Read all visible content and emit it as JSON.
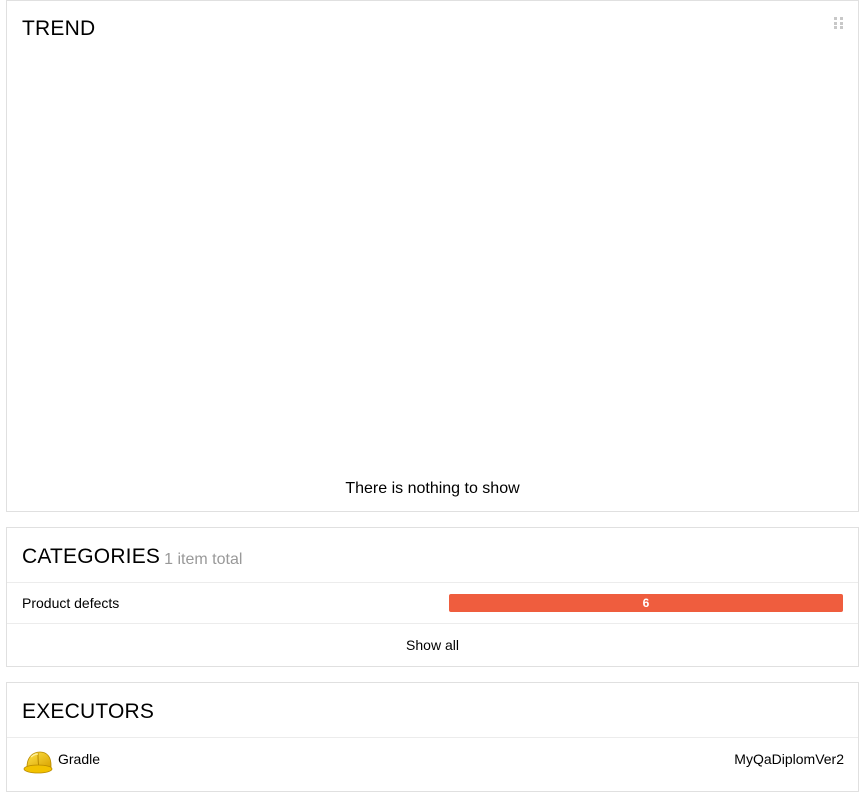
{
  "trend": {
    "title": "TREND",
    "empty_message": "There is nothing to show"
  },
  "categories": {
    "title": "CATEGORIES",
    "subtitle": "1 item total",
    "items": [
      {
        "name": "Product defects",
        "count": "6",
        "fraction": 1.0,
        "color": "#ef5d3e"
      }
    ],
    "show_all_label": "Show all"
  },
  "executors": {
    "title": "EXECUTORS",
    "items": [
      {
        "icon": "hard-hat-icon",
        "name": "Gradle",
        "build": "MyQaDiplomVer2"
      }
    ]
  }
}
